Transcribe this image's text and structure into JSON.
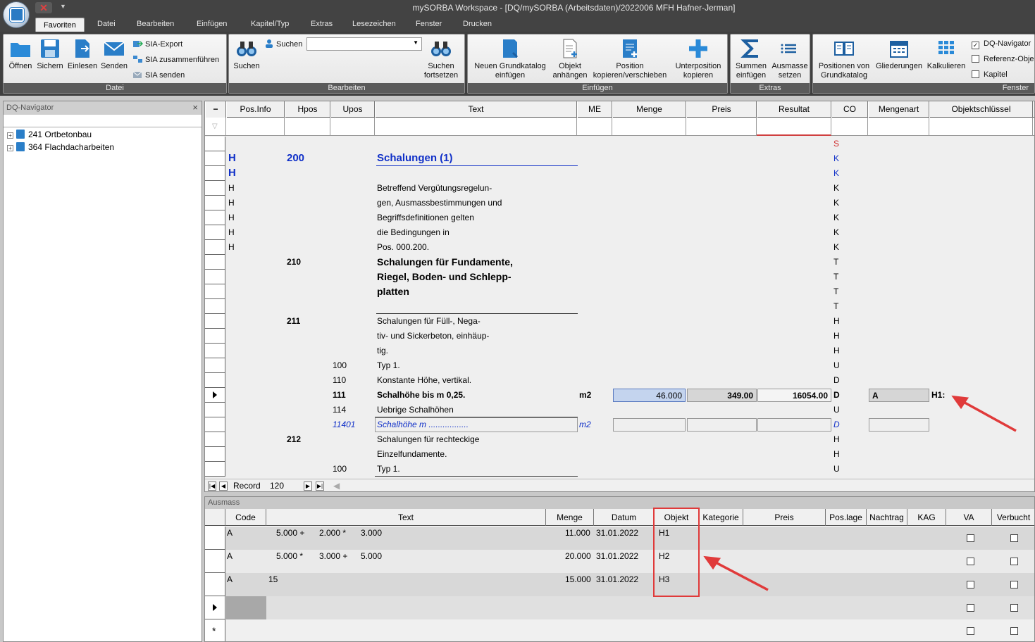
{
  "window": {
    "title": "mySORBA Workspace - [DQ/mySORBA (Arbeitsdaten)/2022006 MFH Hafner-Jerman]"
  },
  "tabs": [
    "Favoriten",
    "Datei",
    "Bearbeiten",
    "Einfügen",
    "Kapitel/Typ",
    "Extras",
    "Lesezeichen",
    "Fenster",
    "Drucken"
  ],
  "ribbon": {
    "datei": {
      "label": "Datei",
      "oeffnen": "Öffnen",
      "sichern": "Sichern",
      "einlesen": "Einlesen",
      "senden": "Senden",
      "sia_export": "SIA-Export",
      "sia_zusammen": "SIA zusammenführen",
      "sia_senden": "SIA senden"
    },
    "bearbeiten": {
      "label": "Bearbeiten",
      "suchen_btn": "Suchen",
      "suchen_label": "Suchen",
      "suchen_value": "",
      "weiter1": "Suchen",
      "weiter2": "fortsetzen"
    },
    "einfuegen": {
      "label": "Einfügen",
      "grund1": "Neuen Grundkatalog",
      "grund2": "einfügen",
      "obj1": "Objekt",
      "obj2": "anhängen",
      "pos1": "Position",
      "pos2": "kopieren/verschieben",
      "unter1": "Unterposition",
      "unter2": "kopieren"
    },
    "extras": {
      "label": "Extras",
      "sum1": "Summen",
      "sum2": "einfügen",
      "aus1": "Ausmasse",
      "aus2": "setzen"
    },
    "fenster": {
      "label": "Fenster",
      "pos1": "Positionen von",
      "pos2": "Grundkatalog",
      "glied": "Gliederungen",
      "kalk": "Kalkulieren",
      "dq_nav": "DQ-Navigator",
      "ref_obj": "Referenz-Obje",
      "kapitel": "Kapitel"
    }
  },
  "navigator": {
    "title": "DQ-Navigator",
    "close": "×",
    "items": [
      "241 Ortbetonbau",
      "364 Flachdacharbeiten"
    ]
  },
  "grid": {
    "headers": [
      "Pos.Info",
      "Hpos",
      "Upos",
      "Text",
      "ME",
      "Menge",
      "Preis",
      "Resultat",
      "CO",
      "Mengenart",
      "Objektschlüssel"
    ],
    "rows": [
      {
        "info": "",
        "hpos": "",
        "upos": "",
        "text": "",
        "me": "",
        "co": "S"
      },
      {
        "info": "H",
        "hpos": "200",
        "upos": "",
        "text": "Schalungen (1)",
        "me": "",
        "co": "K"
      },
      {
        "info": "H",
        "hpos": "",
        "upos": "",
        "text": "",
        "me": "",
        "co": "K"
      },
      {
        "info": "H",
        "hpos": "",
        "upos": "",
        "text": "Betreffend Vergütungsregelun-",
        "me": "",
        "co": "K"
      },
      {
        "info": "H",
        "hpos": "",
        "upos": "",
        "text": "gen, Ausmassbestimmungen und",
        "me": "",
        "co": "K"
      },
      {
        "info": "H",
        "hpos": "",
        "upos": "",
        "text": "Begriffsdefinitionen gelten",
        "me": "",
        "co": "K"
      },
      {
        "info": "H",
        "hpos": "",
        "upos": "",
        "text": "die Bedingungen in",
        "me": "",
        "co": "K"
      },
      {
        "info": "H",
        "hpos": "",
        "upos": "",
        "text": "Pos. 000.200.",
        "me": "",
        "co": "K"
      },
      {
        "info": "",
        "hpos": "210",
        "upos": "",
        "text": "Schalungen für Fundamente,",
        "me": "",
        "co": "T"
      },
      {
        "info": "",
        "hpos": "",
        "upos": "",
        "text": "Riegel, Boden- und Schlepp-",
        "me": "",
        "co": "T"
      },
      {
        "info": "",
        "hpos": "",
        "upos": "",
        "text": "platten",
        "me": "",
        "co": "T"
      },
      {
        "info": "",
        "hpos": "",
        "upos": "",
        "text": "",
        "me": "",
        "co": "T"
      },
      {
        "info": "",
        "hpos": "211",
        "upos": "",
        "text": "Schalungen für Füll-, Nega-",
        "me": "",
        "co": "H"
      },
      {
        "info": "",
        "hpos": "",
        "upos": "",
        "text": "tiv- und Sickerbeton, einhäup-",
        "me": "",
        "co": "H"
      },
      {
        "info": "",
        "hpos": "",
        "upos": "",
        "text": "tig.",
        "me": "",
        "co": "H"
      },
      {
        "info": "",
        "hpos": "",
        "upos": "100",
        "text": "Typ 1.",
        "me": "",
        "co": "U"
      },
      {
        "info": "",
        "hpos": "",
        "upos": "110",
        "text": "Konstante Höhe, vertikal.",
        "me": "",
        "co": "D"
      },
      {
        "info": "",
        "hpos": "",
        "upos": "111",
        "text": "Schalhöhe bis m 0,25.",
        "me": "m2",
        "co": "D",
        "menge": "46.000",
        "preis": "349.00",
        "resultat": "16054.00",
        "mengenart": "A",
        "objekt": "H1:"
      },
      {
        "info": "",
        "hpos": "",
        "upos": "114",
        "text": "Uebrige Schalhöhen",
        "me": "",
        "co": "U"
      },
      {
        "info": "",
        "hpos": "",
        "upos": "11401",
        "text": "Schalhöhe m .................",
        "me": "m2",
        "co": "D"
      },
      {
        "info": "",
        "hpos": "212",
        "upos": "",
        "text": "Schalungen für rechteckige",
        "me": "",
        "co": "H"
      },
      {
        "info": "",
        "hpos": "",
        "upos": "",
        "text": "Einzelfundamente.",
        "me": "",
        "co": "H"
      },
      {
        "info": "",
        "hpos": "",
        "upos": "100",
        "text": "Typ 1.",
        "me": "",
        "co": "U"
      }
    ],
    "record_label": "Record",
    "record_value": "120"
  },
  "ausmass": {
    "title": "Ausmass",
    "headers": [
      "Code",
      "Text",
      "Menge",
      "Datum",
      "Objekt",
      "Kategorie",
      "Preis",
      "Pos.lage",
      "Nachtrag",
      "KAG",
      "VA",
      "Verbucht"
    ],
    "rows": [
      {
        "code": "A",
        "t1": "5.000 +",
        "t2": "2.000 *",
        "t3": "3.000",
        "menge": "11.000",
        "datum": "31.01.2022",
        "objekt": "H1"
      },
      {
        "code": "A",
        "t1": "5.000 *",
        "t2": "3.000 +",
        "t3": "5.000",
        "menge": "20.000",
        "datum": "31.01.2022",
        "objekt": "H2"
      },
      {
        "code": "A",
        "t1": "15",
        "t2": "",
        "t3": "",
        "menge": "15.000",
        "datum": "31.01.2022",
        "objekt": "H3"
      }
    ]
  },
  "colors": {
    "accent_blue": "#1030c8",
    "annotation_red": "#e03a3a",
    "ribbon_dark": "#3f3f3f"
  }
}
